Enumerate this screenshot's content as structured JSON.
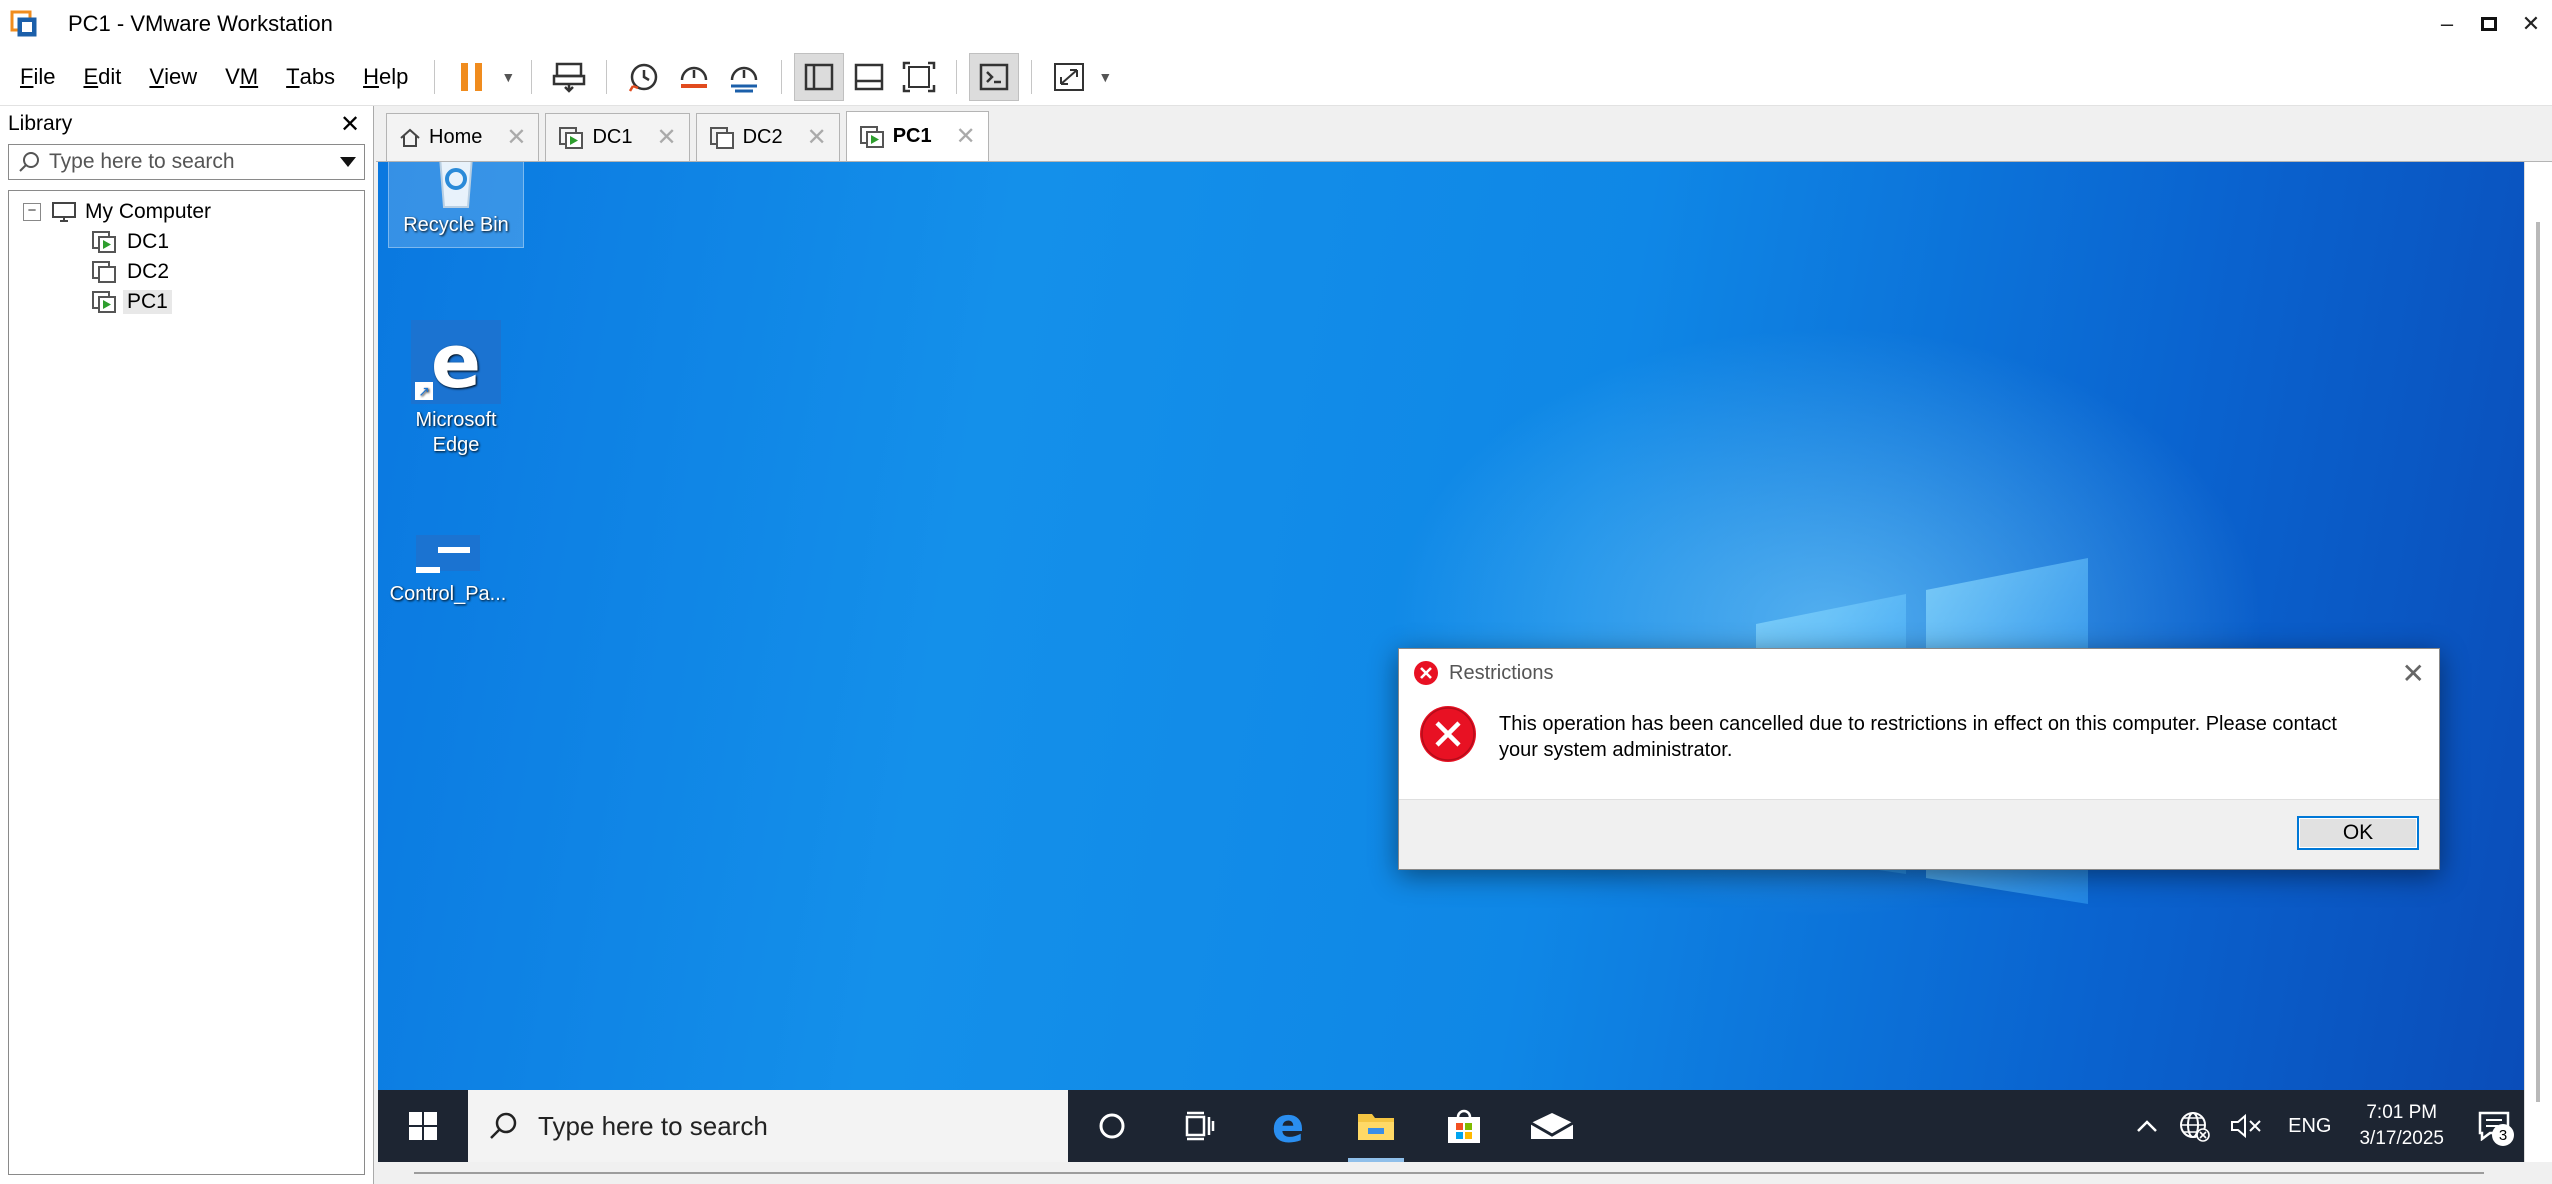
{
  "window": {
    "title": "PC1 - VMware Workstation"
  },
  "menu": {
    "items": [
      {
        "key": "F",
        "rest": "ile"
      },
      {
        "key": "E",
        "rest": "dit"
      },
      {
        "key": "V",
        "rest": "iew"
      },
      {
        "pre": "V",
        "key": "M",
        "rest": ""
      },
      {
        "key": "T",
        "rest": "abs"
      },
      {
        "key": "H",
        "rest": "elp"
      }
    ]
  },
  "library": {
    "title": "Library",
    "search_placeholder": "Type here to search",
    "tree": {
      "root": "My Computer",
      "children": [
        "DC1",
        "DC2",
        "PC1"
      ]
    }
  },
  "tabs": [
    {
      "label": "Home"
    },
    {
      "label": "DC1"
    },
    {
      "label": "DC2"
    },
    {
      "label": "PC1"
    }
  ],
  "desktop": {
    "icons": [
      {
        "label": "Recycle Bin"
      },
      {
        "label": "Microsoft Edge"
      },
      {
        "label": "Control_Pa..."
      }
    ]
  },
  "dialog": {
    "title": "Restrictions",
    "message": "This operation has been cancelled due to restrictions in effect on this computer. Please contact your system administrator.",
    "ok_label": "OK"
  },
  "taskbar": {
    "search_placeholder": "Type here to search",
    "language": "ENG",
    "time": "7:01 PM",
    "date": "3/17/2025",
    "notification_count": "3"
  },
  "colors": {
    "accent": "#0078d7",
    "error_red": "#e81123",
    "pause_orange": "#f08c1e",
    "taskbar": "#1d2532"
  }
}
